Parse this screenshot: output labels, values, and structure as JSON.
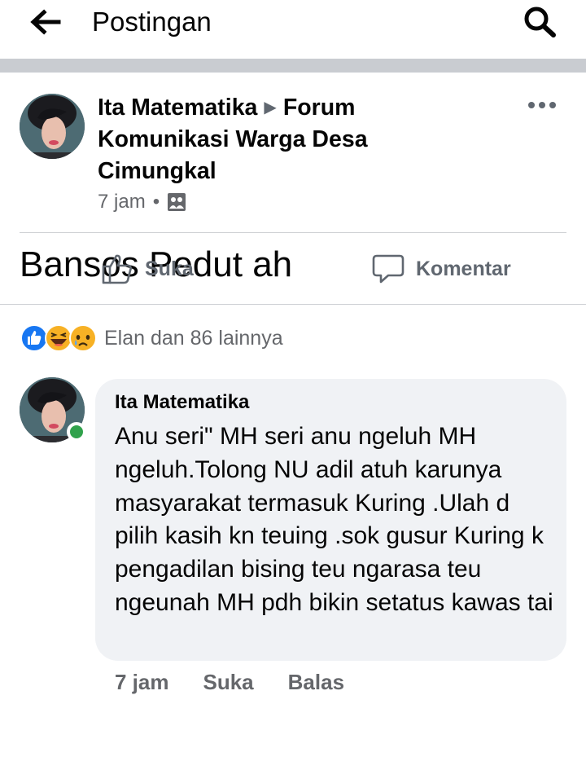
{
  "topbar": {
    "title": "Postingan",
    "back_icon": "arrow-left-icon",
    "search_icon": "search-icon"
  },
  "post": {
    "author": "Ita Matematika",
    "group": "Forum Komunikasi Warga Desa Cimungkal",
    "time": "7 jam",
    "audience_icon": "group-audience-icon",
    "text": "Bansos Pedut ah",
    "actions": {
      "like": "Suka",
      "comment": "Komentar"
    }
  },
  "reactions": {
    "summary": "Elan dan 86 lainnya",
    "icons": [
      "like-reaction-icon",
      "haha-reaction-icon",
      "sad-reaction-icon"
    ]
  },
  "comment": {
    "author": "Ita Matematika",
    "text": "Anu seri\" MH seri anu ngeluh MH ngeluh.Tolong NU adil atuh karunya masyarakat termasuk Kuring .Ulah d pilih kasih kn teuing .sok gusur Kuring k pengadilan bising teu ngarasa teu ngeunah MH pdh bikin setatus kawas tai",
    "time": "7 jam",
    "like": "Suka",
    "reply": "Balas"
  },
  "colors": {
    "facebook_blue": "#1877f2",
    "online_green": "#31a24c",
    "bubble_bg": "#f0f2f5",
    "secondary_text": "#65676b"
  }
}
